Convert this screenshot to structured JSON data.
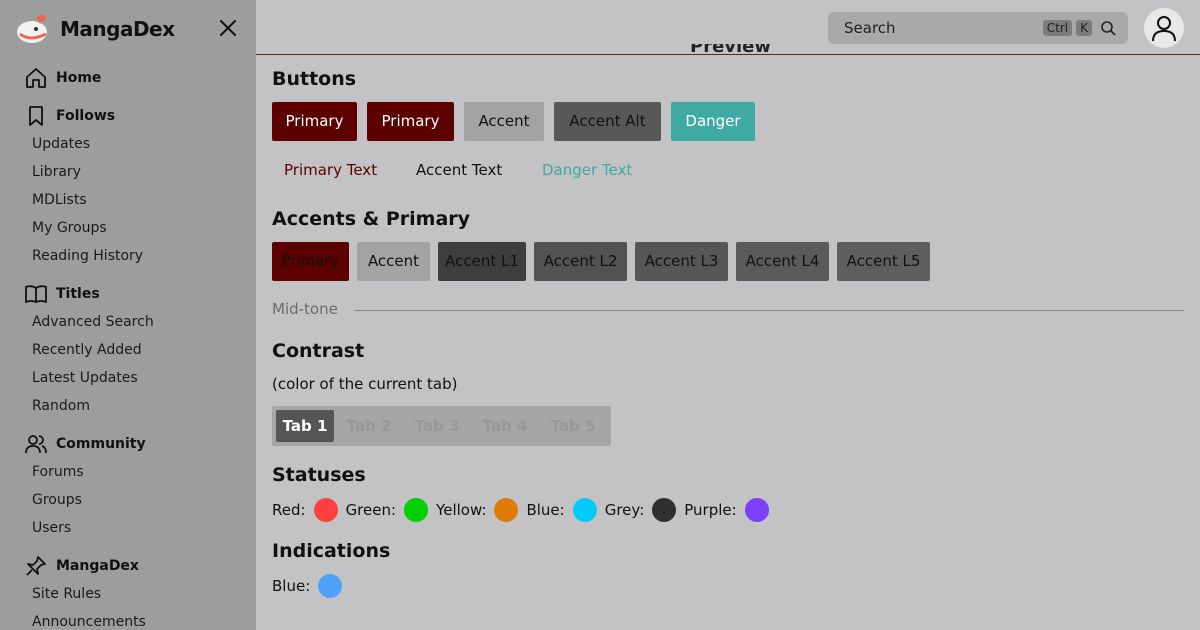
{
  "app": {
    "name": "MangaDex"
  },
  "sidebar": {
    "sections": [
      {
        "label": "Home",
        "icon": "home-icon",
        "items": []
      },
      {
        "label": "Follows",
        "icon": "bookmark-icon",
        "items": [
          "Updates",
          "Library",
          "MDLists",
          "My Groups",
          "Reading History"
        ]
      },
      {
        "label": "Titles",
        "icon": "book-icon",
        "items": [
          "Advanced Search",
          "Recently Added",
          "Latest Updates",
          "Random"
        ]
      },
      {
        "label": "Community",
        "icon": "users-icon",
        "items": [
          "Forums",
          "Groups",
          "Users"
        ]
      },
      {
        "label": "MangaDex",
        "icon": "pin-icon",
        "items": [
          "Site Rules",
          "Announcements"
        ]
      }
    ]
  },
  "header": {
    "search_placeholder": "Search",
    "kbd_ctrl": "Ctrl",
    "kbd_k": "K",
    "peek_title": "Preview"
  },
  "buttons_section": {
    "title": "Buttons",
    "buttons": [
      {
        "label": "Primary",
        "bg": "#5c0000",
        "fg": "#ffffff"
      },
      {
        "label": "Primary",
        "bg": "#5c0000",
        "fg": "#ffffff"
      },
      {
        "label": "Accent",
        "bg": "#a3a3a3",
        "fg": "#111111"
      },
      {
        "label": "Accent Alt",
        "bg": "#585858",
        "fg": "#111111"
      },
      {
        "label": "Danger",
        "bg": "#3fa9a4",
        "fg": "#ffffff"
      }
    ],
    "text_buttons": [
      {
        "label": "Primary Text",
        "fg": "#5c0000"
      },
      {
        "label": "Accent Text",
        "fg": "#111111"
      },
      {
        "label": "Danger Text",
        "fg": "#3fa9a4"
      }
    ]
  },
  "accents_section": {
    "title": "Accents & Primary",
    "swatches": [
      {
        "label": "Primary",
        "bg": "#5c0000",
        "fg": "#111111"
      },
      {
        "label": "Accent",
        "bg": "#a3a3a3",
        "fg": "#111111"
      },
      {
        "label": "Accent L1",
        "bg": "#3e3e3e",
        "fg": "#111111"
      },
      {
        "label": "Accent L2",
        "bg": "#525252",
        "fg": "#111111"
      },
      {
        "label": "Accent L3",
        "bg": "#565656",
        "fg": "#111111"
      },
      {
        "label": "Accent L4",
        "bg": "#5a5a5a",
        "fg": "#111111"
      },
      {
        "label": "Accent L5",
        "bg": "#5e5e5e",
        "fg": "#111111"
      }
    ],
    "midtone_label": "Mid-tone"
  },
  "contrast_section": {
    "title": "Contrast",
    "note": "(color of the current tab)",
    "tabs": [
      "Tab 1",
      "Tab 2",
      "Tab 3",
      "Tab 4",
      "Tab 5"
    ],
    "active_tab": "Tab 1"
  },
  "statuses_section": {
    "title": "Statuses",
    "items": [
      {
        "label": "Red:",
        "color": "#ff4040"
      },
      {
        "label": "Green:",
        "color": "#04d000"
      },
      {
        "label": "Yellow:",
        "color": "#e07a0a"
      },
      {
        "label": "Blue:",
        "color": "#04cbfb"
      },
      {
        "label": "Grey:",
        "color": "#2f2f2f"
      },
      {
        "label": "Purple:",
        "color": "#7b40f9"
      }
    ]
  },
  "indications_section": {
    "title": "Indications",
    "items": [
      {
        "label": "Blue:",
        "color": "#4fa1f5"
      }
    ]
  }
}
